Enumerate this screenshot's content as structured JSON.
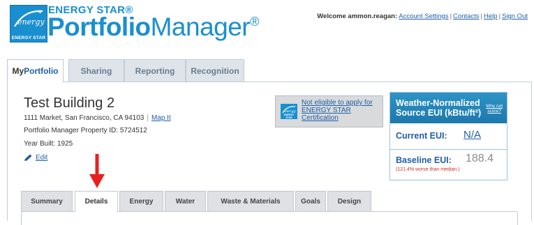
{
  "brand": {
    "logo_text": "ENERGY STAR",
    "line1": "ENERGY STAR®",
    "word_bold": "Portfolio",
    "word_light": "Manager",
    "reg_mark": "®"
  },
  "userbar": {
    "welcome": "Welcome ammon.reagan:",
    "links": [
      "Account Settings",
      "Contacts",
      "Help",
      "Sign Out"
    ],
    "separator": "|"
  },
  "main_tabs": [
    {
      "prefix": "My",
      "label": "Portfolio",
      "active": true
    },
    {
      "label": "Sharing"
    },
    {
      "label": "Reporting"
    },
    {
      "label": "Recognition"
    }
  ],
  "building": {
    "name": "Test Building 2",
    "address": "1111 Market, San Francisco, CA 94103",
    "separator": "|",
    "map_link": "Map It",
    "property_id": "Portfolio Manager Property ID: 5724512",
    "year_built": "Year Built: 1925",
    "edit_link": "Edit"
  },
  "eligibility": {
    "logo_text": "ENERGY STAR",
    "text": "Not eligible to apply for ENERGY STAR Certification"
  },
  "eui": {
    "title_line1": "Weather-Normalized",
    "title_line2": "Source EUI (kBtu/ft²)",
    "why_line1": "Why not",
    "why_line2": "score?",
    "current_label": "Current EUI:",
    "current_value": "N/A",
    "baseline_label": "Baseline EUI:",
    "baseline_value": "188.4",
    "baseline_note": "(121.4% worse than median.)"
  },
  "sub_tabs": [
    {
      "label": "Summary"
    },
    {
      "label": "Details",
      "active": true
    },
    {
      "label": "Energy"
    },
    {
      "label": "Water"
    },
    {
      "label": "Waste & Materials"
    },
    {
      "label": "Goals"
    },
    {
      "label": "Design"
    }
  ],
  "colors": {
    "brand_blue": "#1a8fd0",
    "link_blue": "#1f5fa8",
    "eui_header": "#1d78ac",
    "annotation_red": "#e8211f",
    "warning_red": "#d12c2c"
  },
  "icons": {
    "edit": "pencil-icon",
    "annotation": "red-arrow-down-icon"
  }
}
